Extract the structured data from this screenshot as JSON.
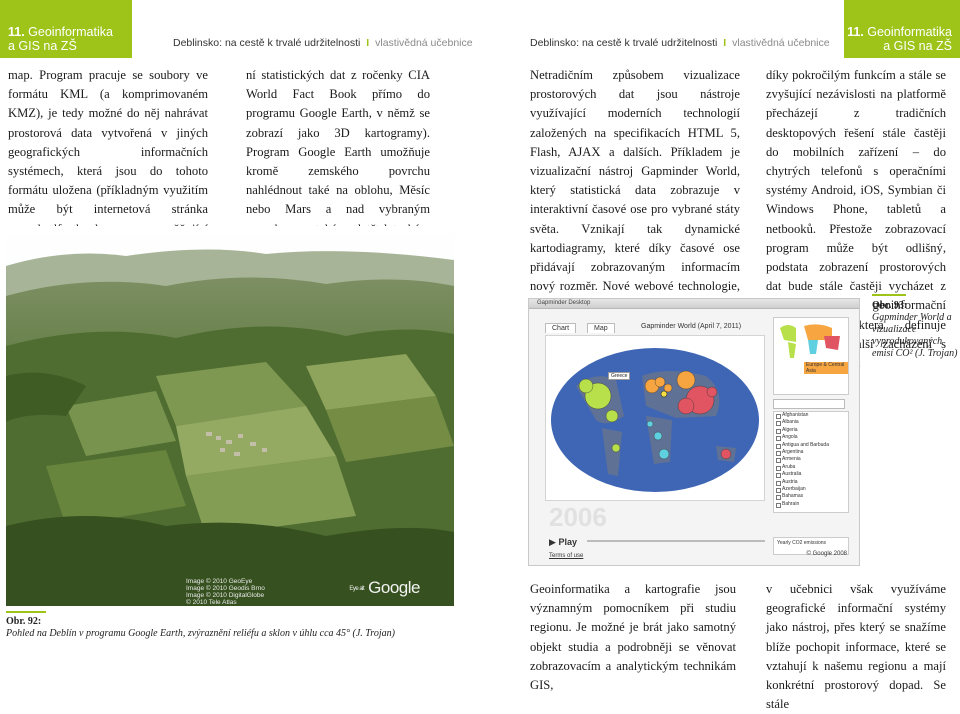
{
  "header_left": {
    "chapter_number": "11.",
    "chapter_title_1": "Geoinformatika",
    "chapter_title_2": "a GIS na ZŠ",
    "running_title": "Deblinsko: na cestě k trvalé udržitelnosti",
    "separator": "I",
    "running_subtitle": "vlastivědná učebnice"
  },
  "header_right": {
    "chapter_number": "11.",
    "chapter_title_1": "Geoinformatika",
    "chapter_title_2": "a GIS na ZŠ",
    "running_title": "Deblinsko: na cestě k trvalé udržitelnosti",
    "separator": "I",
    "running_subtitle": "vlastivědná učebnice"
  },
  "left_page": {
    "column_1": "map. Program pracuje se soubory ve formátu KML (a komprimovaném KMZ), je tedy možné do něj nahrávat prostorová data vytvořená v jiných geografických informačních systémech, která jsou do tohoto formátu uložena (příkladným využitím může být internetová stránka www.kmlfactbook.org umožňující staže-",
    "column_2": "ní statistických dat z ročenky CIA World Fact Book přímo do programu Google Earth, v němž se zobrazí jako 3D kartogramy). Program Google Earth umožňuje kromě zemského povrchu nahlédnout také na oblohu, Měsíc nebo Mars a nad vybraným povrchem se také proletět leteckým simulátorem.",
    "image_copyright": [
      "Image © 2010 GeoEye",
      "Image © 2010 Geodis Brno",
      "Image © 2010 DigitalGlobe",
      "© 2010 Tele Atlas"
    ],
    "image_logo": "Google",
    "image_logo_small": "Eye alt",
    "caption_label": "Obr. 92:",
    "caption_text": "Pohled na Deblín v programu Google Earth, zvýraznění reliéfu a sklon v úhlu cca 45° (J. Trojan)"
  },
  "right_page": {
    "column_1": "Netradičním způsobem vizualizace prostorových dat jsou nástroje využívající moderních technologií založených na specifikacích HTML 5, Flash, AJAX a dalších. Příkladem je vizualizační nástroj Gapminder World, který statistická data zobrazuje v interaktivní časové ose pro vybrané státy světa. Vznikají tak dynamické kartodiagramy, které díky časové ose přidávají zobrazovaným informacím nový rozměr. Nové webové technologie, někdy souhrnně nazývané jako Web 2.0,",
    "column_2": "díky pokročilým funkcím a stále se zvyšující nezávislosti na platformě přecházejí z tradičních desktopových řešení stále častěji do mobilních zařízení – do chytrých telefonů s operačními systémy Android, iOS, Symbian či Windows Phone, tabletů a netbooků. Přestože zobrazovací program může být odlišný, podstata zobrazení prostorových dat bude stále častěji vycházet z jednotné geoinformační infrastruktury, která definuje standardy pro další zacházení s prostorovými daty.",
    "column_3": "Geoinformatika a kartografie jsou významným pomocníkem při studiu regionu. Je možné je brát jako samotný objekt studia a podrobněji se věnovat zobrazovacím a analytickým technikám GIS,",
    "column_4": "v učebnici však využíváme geografické informační systémy jako nástroj, přes který se snažíme blíže pochopit informace, které se vztahují k našemu regionu a mají konkrétní prostorový dopad. Se stále",
    "caption_label": "Obr. 93:",
    "caption_text": "Gapminder World a vizualizace vyprodukovaných emisí CO² (J. Trojan)"
  },
  "gapminder": {
    "window_title": "Gapminder Desktop",
    "tab_chart": "Chart",
    "tab_map": "Map",
    "map_title": "Gapminder World (April 7, 2011)",
    "highlight_label": "Greece",
    "legend_label": "Europe & Central Asia",
    "year": "2006",
    "play_label": "Play",
    "terms_label": "Terms of use",
    "size_label": "Yearly CO2 emissions",
    "google_label": "© Google 2008",
    "countries": [
      "Afghanistan",
      "Albania",
      "Algeria",
      "Angola",
      "Antigua and Barbuda",
      "Argentina",
      "Armenia",
      "Aruba",
      "Australia",
      "Austria",
      "Azerbaijan",
      "Bahamas",
      "Bahrain"
    ],
    "colors": {
      "ocean": "#3f66b5",
      "europe": "#f7a541",
      "americas": "#b7e04a",
      "africa": "#5fd0e0",
      "asia": "#e05561",
      "greece": "#f7e041"
    }
  },
  "colors": {
    "accent": "#9ec41a",
    "text": "#1a1a1a"
  }
}
